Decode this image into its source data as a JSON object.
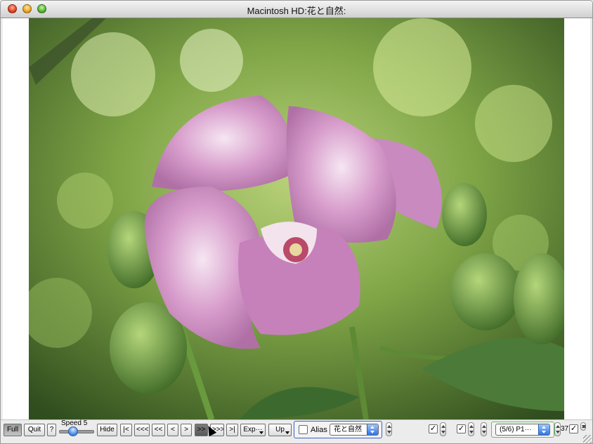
{
  "window": {
    "title": "Macintosh HD:花と自然:"
  },
  "toolbar": {
    "full_label": "Full",
    "quit_label": "Quit",
    "help_label": "?",
    "speed_label": "Speed 5",
    "speed_value": 5,
    "hide_label": "Hide",
    "first_label": "|<",
    "back3_label": "<<<",
    "back2_label": "<<",
    "back1_label": "<",
    "fwd1_label": ">",
    "fwd2_label": ">>",
    "fwd3_label": ">>>",
    "last_label": ">|",
    "export_label": "Exp···",
    "up_label": "Up",
    "alias_label": "Alias",
    "alias_folder": "花と自然",
    "position_label": "(5/6) P1···",
    "count_value": "37"
  },
  "colors": {
    "accent_blue": "#3a63c8",
    "green_outline": "#5dc25d"
  }
}
